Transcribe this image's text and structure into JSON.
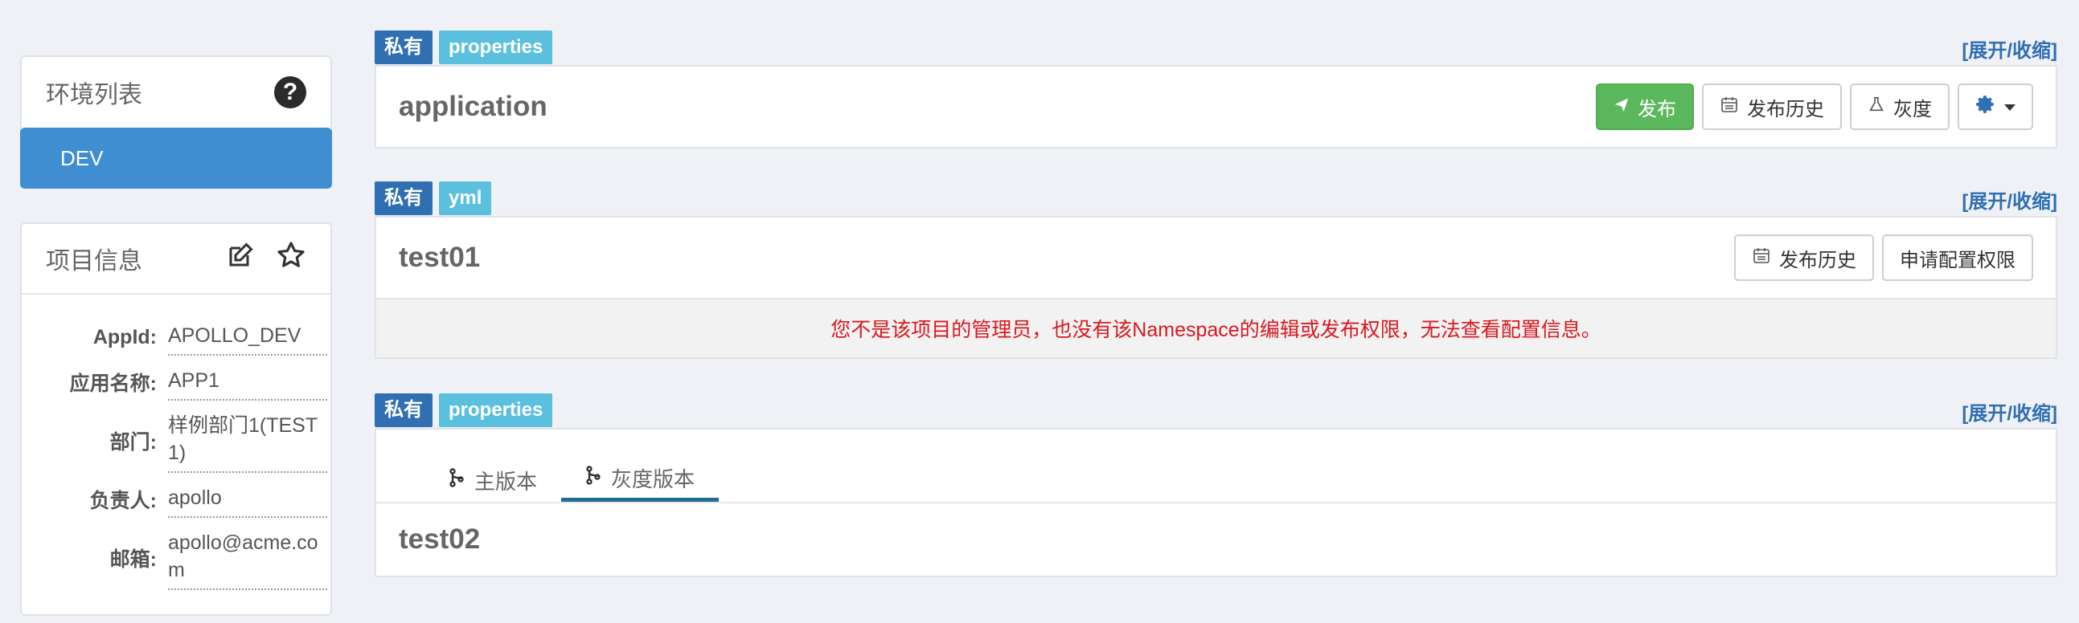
{
  "env_panel": {
    "title": "环境列表",
    "help_icon": "question-circle-icon",
    "items": [
      {
        "label": "DEV",
        "active": true
      }
    ]
  },
  "info_panel": {
    "title": "项目信息",
    "rows": [
      {
        "label": "AppId:",
        "value": "APOLLO_DEV"
      },
      {
        "label": "应用名称:",
        "value": "APP1"
      },
      {
        "label": "部门:",
        "value": "样例部门1(TEST1)"
      },
      {
        "label": "负责人:",
        "value": "apollo"
      },
      {
        "label": "邮箱:",
        "value": "apollo@acme.com"
      }
    ]
  },
  "namespaces": [
    {
      "tag_private": "私有",
      "tag_format": "properties",
      "toggle": "[展开/收缩]",
      "name": "application",
      "buttons": {
        "publish": "发布",
        "history": "发布历史",
        "gray": "灰度"
      }
    },
    {
      "tag_private": "私有",
      "tag_format": "yml",
      "toggle": "[展开/收缩]",
      "name": "test01",
      "buttons": {
        "history": "发布历史",
        "request": "申请配置权限"
      },
      "warning": "您不是该项目的管理员，也没有该Namespace的编辑或发布权限，无法查看配置信息。"
    },
    {
      "tag_private": "私有",
      "tag_format": "properties",
      "toggle": "[展开/收缩]",
      "tabs": [
        {
          "label": "主版本"
        },
        {
          "label": "灰度版本",
          "active": true
        }
      ],
      "name": "test02"
    }
  ],
  "colors": {
    "primary": "#3f8ed1",
    "tag_private": "#2f6fb2",
    "tag_format": "#5bc0de",
    "success": "#5cb85c",
    "warning_text": "#d9181e",
    "background": "#eff1f6"
  }
}
